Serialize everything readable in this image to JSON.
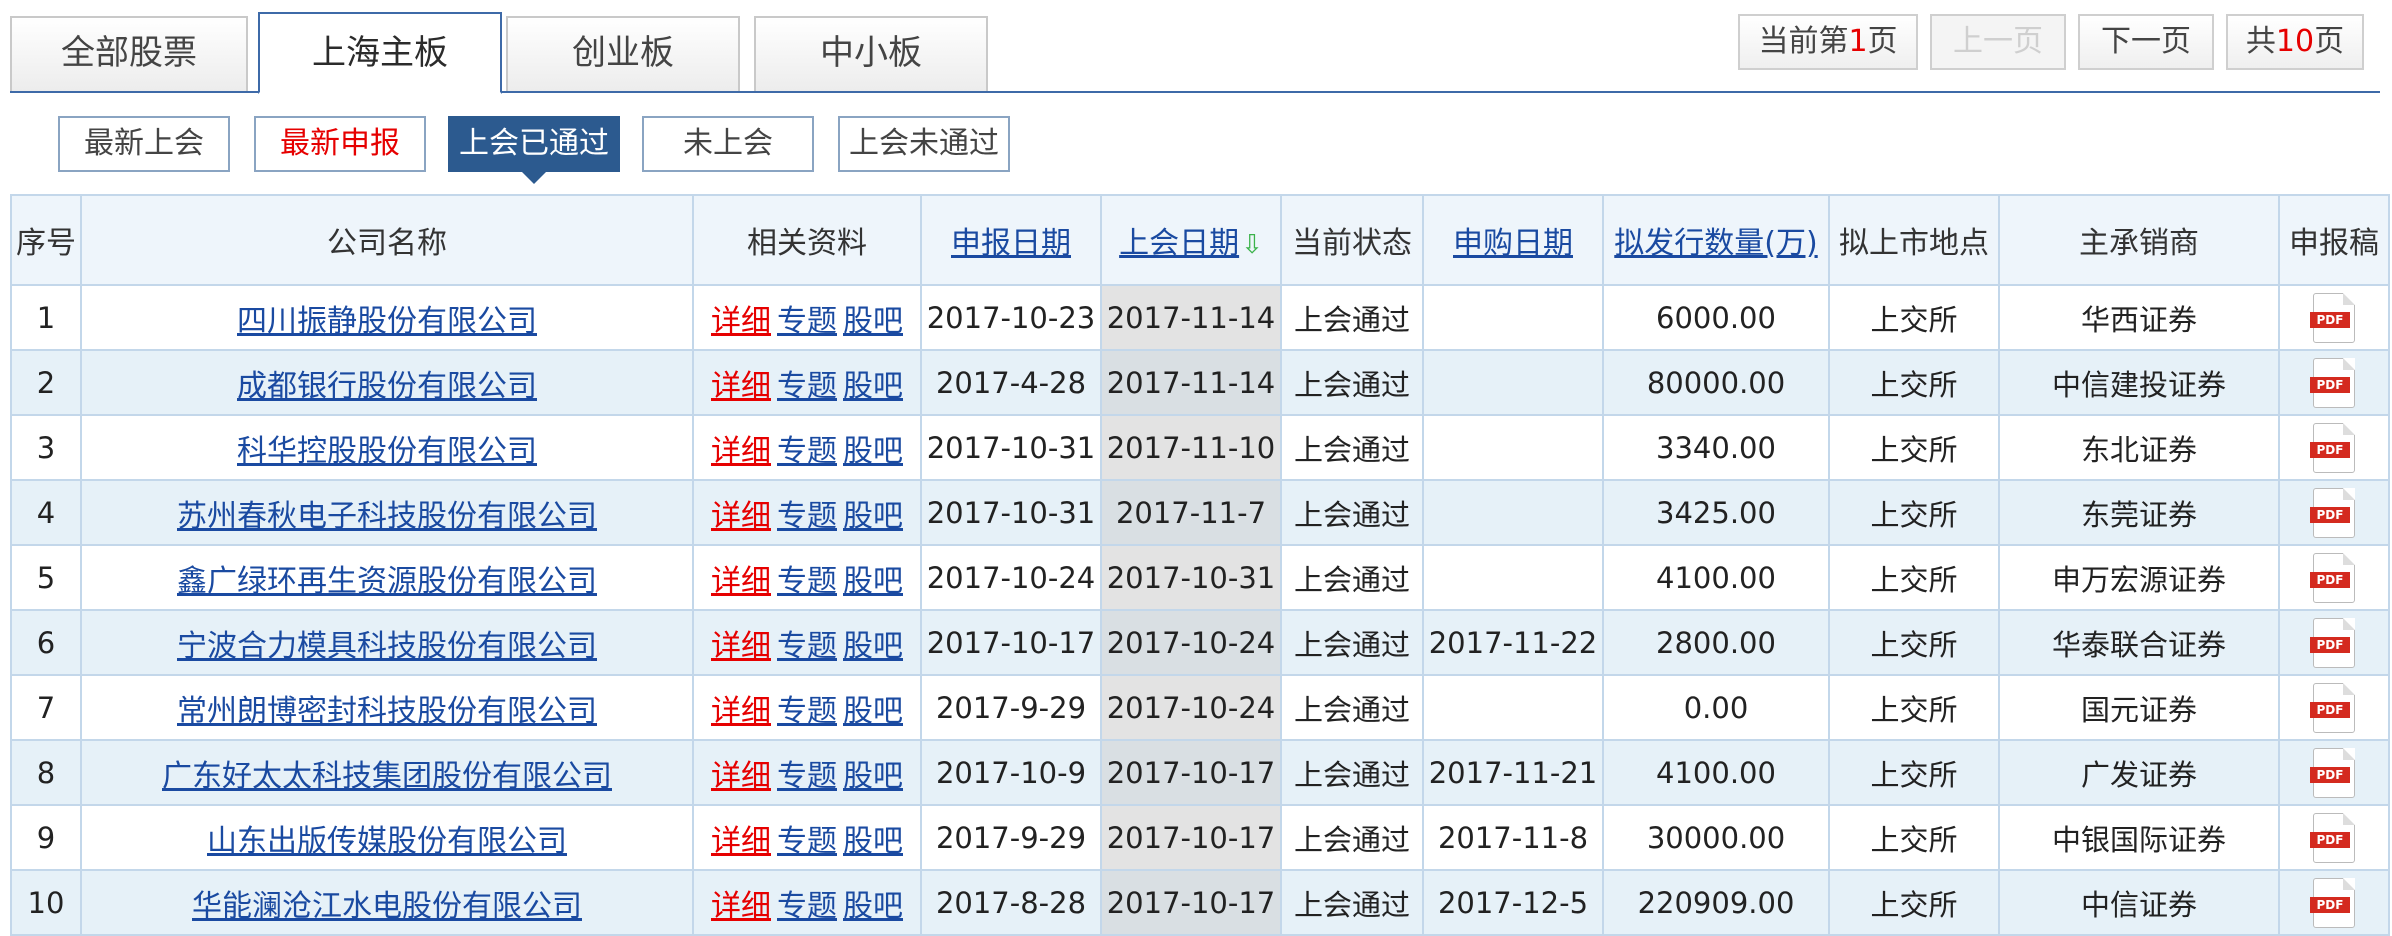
{
  "tabs": [
    "全部股票",
    "上海主板",
    "创业板",
    "中小板"
  ],
  "active_tab": "上海主板",
  "pager": {
    "current_prefix": "当前第",
    "current_page": "1",
    "current_suffix": "页",
    "prev": "上一页",
    "next": "下一页",
    "total_prefix": "共",
    "total_pages": "10",
    "total_suffix": "页"
  },
  "filters": [
    "最新上会",
    "最新申报",
    "上会已通过",
    "未上会",
    "上会未通过"
  ],
  "active_filter": "上会已通过",
  "table": {
    "headers": {
      "seq": "序号",
      "company": "公司名称",
      "docs": "相关资料",
      "apply_date": "申报日期",
      "meeting_date": "上会日期",
      "status": "当前状态",
      "subscribe_date": "申购日期",
      "issue_amount": "拟发行数量(万)",
      "exchange": "拟上市地点",
      "underwriter": "主承销商",
      "filing": "申报稿"
    },
    "link_labels": {
      "detail": "详细",
      "topic": "专题",
      "forum": "股吧"
    },
    "pdf_label": "PDF",
    "rows": [
      {
        "seq": "1",
        "company": "四川振静股份有限公司",
        "apply_date": "2017-10-23",
        "meeting_date": "2017-11-14",
        "status": "上会通过",
        "subscribe_date": "",
        "issue_amount": "6000.00",
        "exchange": "上交所",
        "underwriter": "华西证券"
      },
      {
        "seq": "2",
        "company": "成都银行股份有限公司",
        "apply_date": "2017-4-28",
        "meeting_date": "2017-11-14",
        "status": "上会通过",
        "subscribe_date": "",
        "issue_amount": "80000.00",
        "exchange": "上交所",
        "underwriter": "中信建投证券"
      },
      {
        "seq": "3",
        "company": "科华控股股份有限公司",
        "apply_date": "2017-10-31",
        "meeting_date": "2017-11-10",
        "status": "上会通过",
        "subscribe_date": "",
        "issue_amount": "3340.00",
        "exchange": "上交所",
        "underwriter": "东北证券"
      },
      {
        "seq": "4",
        "company": "苏州春秋电子科技股份有限公司",
        "apply_date": "2017-10-31",
        "meeting_date": "2017-11-7",
        "status": "上会通过",
        "subscribe_date": "",
        "issue_amount": "3425.00",
        "exchange": "上交所",
        "underwriter": "东莞证券"
      },
      {
        "seq": "5",
        "company": "鑫广绿环再生资源股份有限公司",
        "apply_date": "2017-10-24",
        "meeting_date": "2017-10-31",
        "status": "上会通过",
        "subscribe_date": "",
        "issue_amount": "4100.00",
        "exchange": "上交所",
        "underwriter": "申万宏源证券"
      },
      {
        "seq": "6",
        "company": "宁波合力模具科技股份有限公司",
        "apply_date": "2017-10-17",
        "meeting_date": "2017-10-24",
        "status": "上会通过",
        "subscribe_date": "2017-11-22",
        "issue_amount": "2800.00",
        "exchange": "上交所",
        "underwriter": "华泰联合证券"
      },
      {
        "seq": "7",
        "company": "常州朗博密封科技股份有限公司",
        "apply_date": "2017-9-29",
        "meeting_date": "2017-10-24",
        "status": "上会通过",
        "subscribe_date": "",
        "issue_amount": "0.00",
        "exchange": "上交所",
        "underwriter": "国元证券"
      },
      {
        "seq": "8",
        "company": "广东好太太科技集团股份有限公司",
        "apply_date": "2017-10-9",
        "meeting_date": "2017-10-17",
        "status": "上会通过",
        "subscribe_date": "2017-11-21",
        "issue_amount": "4100.00",
        "exchange": "上交所",
        "underwriter": "广发证券"
      },
      {
        "seq": "9",
        "company": "山东出版传媒股份有限公司",
        "apply_date": "2017-9-29",
        "meeting_date": "2017-10-17",
        "status": "上会通过",
        "subscribe_date": "2017-11-8",
        "issue_amount": "30000.00",
        "exchange": "上交所",
        "underwriter": "中银国际证券"
      },
      {
        "seq": "10",
        "company": "华能澜沧江水电股份有限公司",
        "apply_date": "2017-8-28",
        "meeting_date": "2017-10-17",
        "status": "上会通过",
        "subscribe_date": "2017-12-5",
        "issue_amount": "220909.00",
        "exchange": "上交所",
        "underwriter": "中信证券"
      }
    ]
  },
  "colors": {
    "accent_blue": "#2c5a8f",
    "link_blue": "#1a4aa1",
    "highlight_red": "#e60000",
    "header_bg": "#eef5fb",
    "row_alt_bg": "#e6f1f8",
    "sort_arrow": "#3bb24a",
    "pdf_red": "#d42a1f"
  }
}
